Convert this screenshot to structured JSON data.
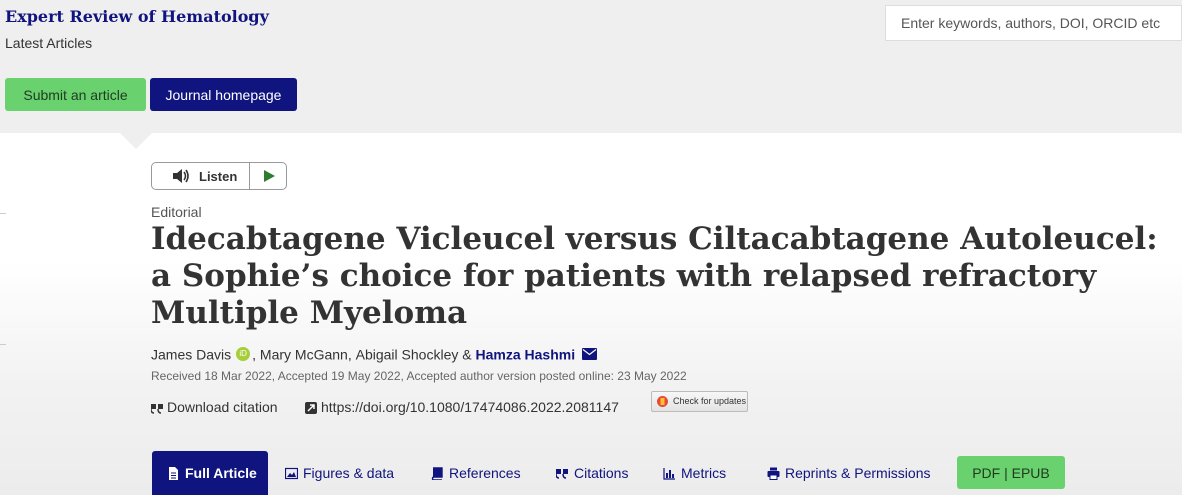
{
  "header": {
    "journal_title": "Expert Review of Hematology",
    "journal_chevron": "›",
    "latest_articles": "Latest Articles",
    "search_placeholder": "Enter keywords, authors, DOI, ORCID etc"
  },
  "actions": {
    "submit_label": "Submit an article",
    "journal_homepage_label": "Journal homepage"
  },
  "listen": {
    "label": "Listen"
  },
  "article": {
    "type": "Editorial",
    "title": "Idecabtagene Vicleucel versus Ciltacabtagene Autoleucel: a Sophie’s choice for patients with relapsed refractory Multiple Myeloma",
    "authors": [
      {
        "name": "James Davis",
        "orcid_label": "iD"
      },
      {
        "name": "Mary McGann"
      },
      {
        "name": "Abigail Shockley"
      },
      {
        "name": "Hamza Hashmi"
      }
    ],
    "author_separators": [
      ", ",
      ", ",
      " & "
    ],
    "dates": "Received 18 Mar 2022, Accepted 19 May 2022, Accepted author version posted online: 23 May 2022",
    "download_citation": "Download citation",
    "doi": "https://doi.org/10.1080/17474086.2022.2081147",
    "check_updates": "Check for updates"
  },
  "tabs": [
    {
      "label": "Full Article",
      "icon": "document-icon",
      "active": true
    },
    {
      "label": "Figures & data",
      "icon": "image-icon"
    },
    {
      "label": "References",
      "icon": "book-icon"
    },
    {
      "label": "Citations",
      "icon": "quote-icon"
    },
    {
      "label": "Metrics",
      "icon": "bar-chart-icon"
    },
    {
      "label": "Reprints & Permissions",
      "icon": "print-icon"
    }
  ],
  "pdf_epub_label": "PDF | EPUB",
  "colors": {
    "brand_navy": "#10147e",
    "accent_green": "#6ad16f",
    "orcid_green": "#a6ce39",
    "background_gray": "#efefef"
  }
}
